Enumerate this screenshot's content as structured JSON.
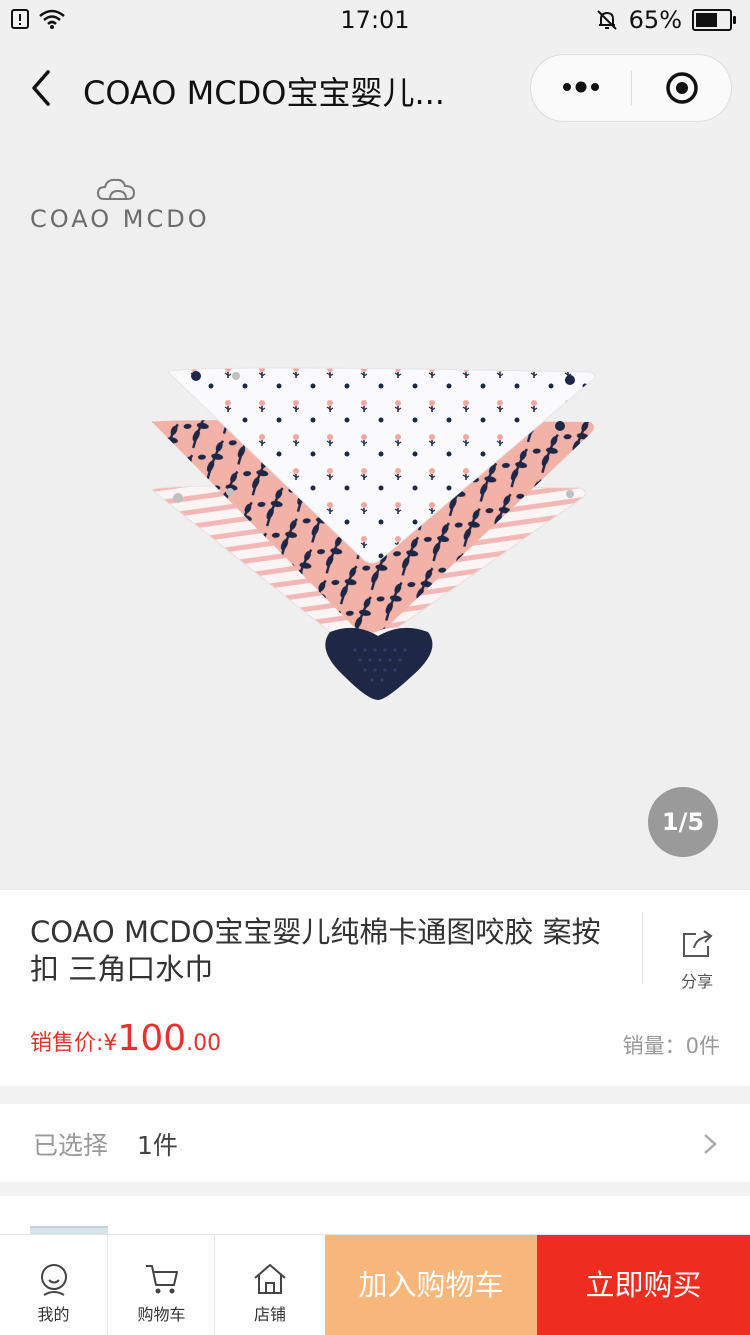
{
  "status_bar": {
    "time": "17:01",
    "battery": "65%",
    "battery_level": 0.65
  },
  "nav": {
    "title": "COAO MCDO宝宝婴儿..."
  },
  "gallery": {
    "brand": "COAO MCDO",
    "pager": "1/5"
  },
  "product": {
    "title": "COAO MCDO宝宝婴儿纯棉卡通图咬胶 案按扣 三角口水巾",
    "share_label": "分享",
    "price_label": "销售价:¥",
    "price_int": "100",
    "price_dec": ".00",
    "sales": "销量：0件"
  },
  "selection": {
    "label": "已选择",
    "value": "1件"
  },
  "store_row": {
    "text": "..."
  },
  "bottom_bar": {
    "items": [
      {
        "label": "我的",
        "icon": "user-icon"
      },
      {
        "label": "购物车",
        "icon": "cart-icon"
      },
      {
        "label": "店铺",
        "icon": "home-icon"
      }
    ],
    "add_to_cart": "加入购物车",
    "buy_now": "立即购买"
  },
  "colors": {
    "price": "#e5322d",
    "add_to_cart": "#f7b77a",
    "buy_now": "#ef2c20"
  }
}
